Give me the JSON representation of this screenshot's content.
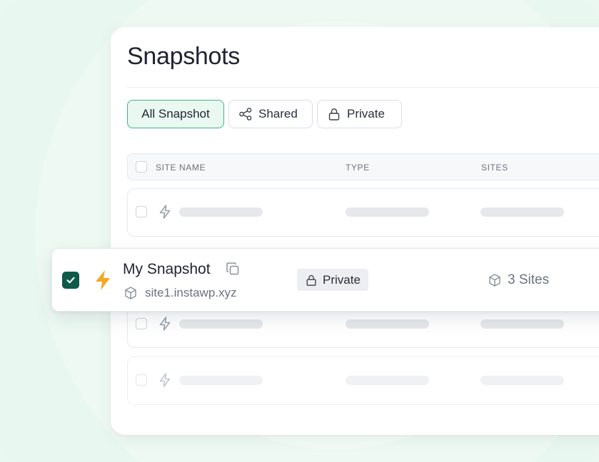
{
  "page": {
    "title": "Snapshots"
  },
  "tabs": [
    {
      "label": "All Snapshot",
      "icon": "none",
      "active": true
    },
    {
      "label": "Shared",
      "icon": "share-icon",
      "active": false
    },
    {
      "label": "Private",
      "icon": "lock-icon",
      "active": false
    }
  ],
  "table": {
    "columns": [
      "SITE NAME",
      "TYPE",
      "SITES"
    ]
  },
  "highlighted_row": {
    "checked": true,
    "name": "My Snapshot",
    "site": "site1.instawp.xyz",
    "type": "Private",
    "sites": "3 Sites"
  },
  "colors": {
    "accent": "#41b58a",
    "check": "#0f5a48",
    "bolt": "#f5a623"
  }
}
